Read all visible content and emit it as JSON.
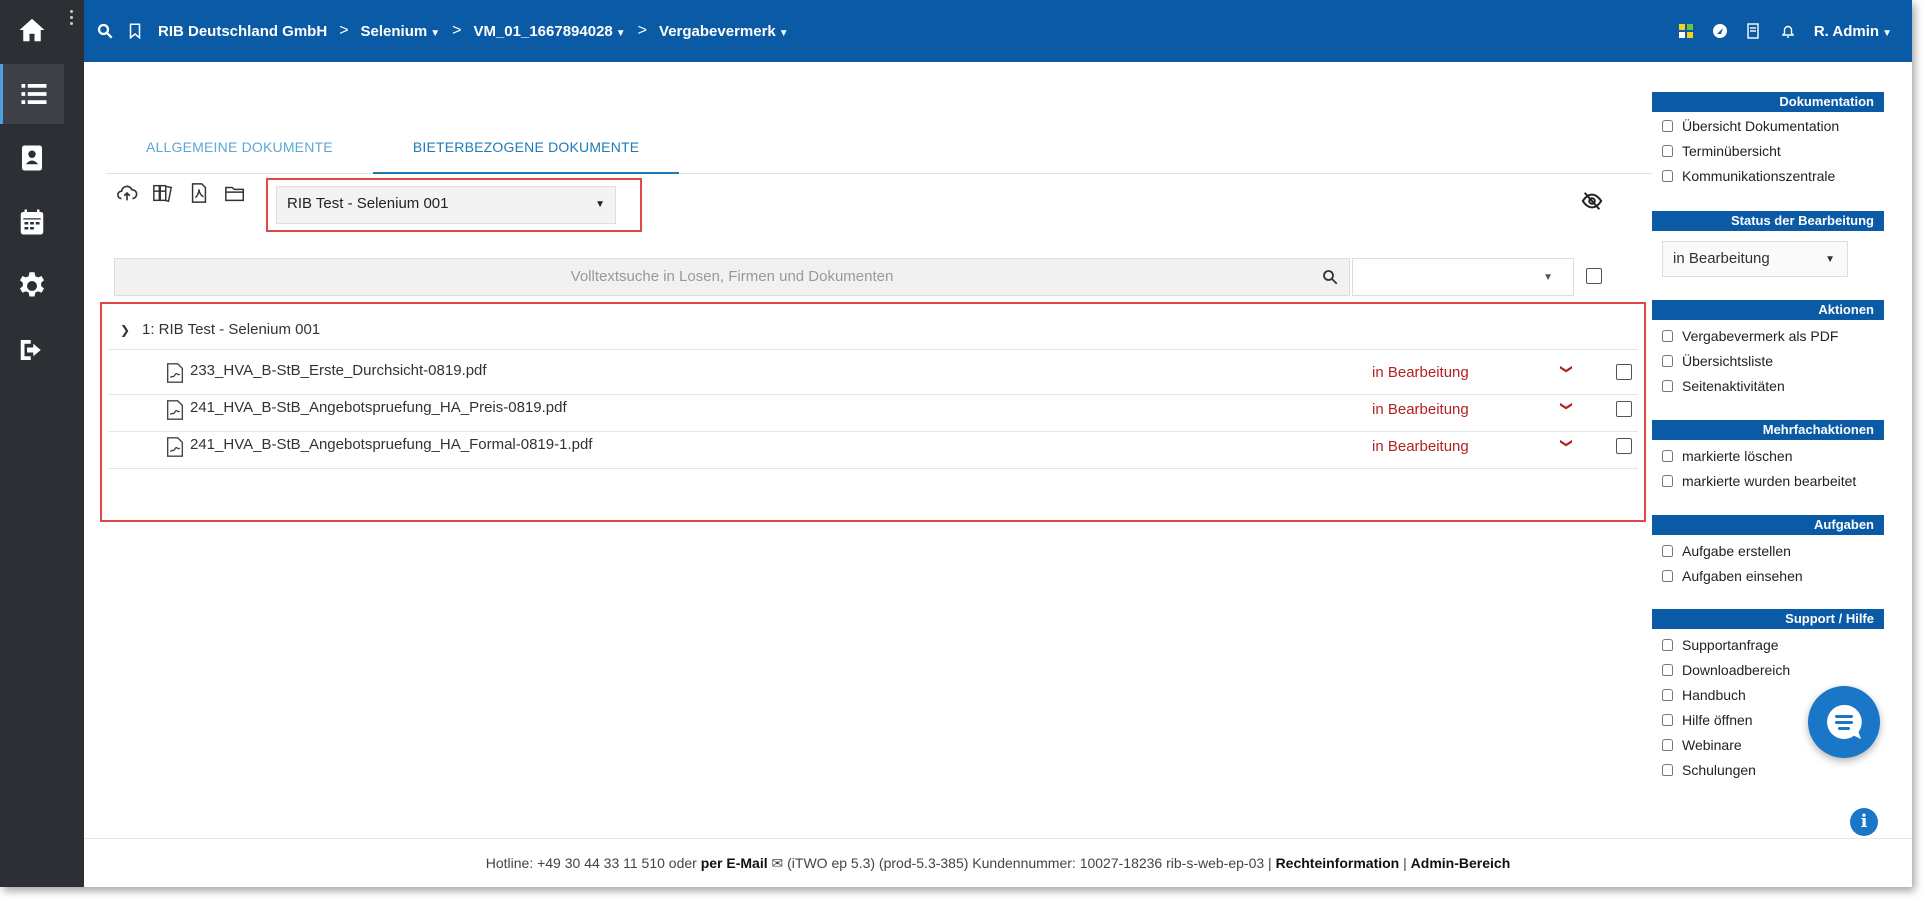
{
  "header": {
    "breadcrumb": [
      {
        "label": "RIB Deutschland GmbH",
        "dropdown": false
      },
      {
        "label": "Selenium",
        "dropdown": true
      },
      {
        "label": "VM_01_1667894028",
        "dropdown": true
      },
      {
        "label": "Vergabevermerk",
        "dropdown": true
      }
    ],
    "user": "R. Admin"
  },
  "tabs": [
    {
      "label": "ALLGEMEINE DOKUMENTE",
      "active": false
    },
    {
      "label": "BIETERBEZOGENE DOKUMENTE",
      "active": true
    }
  ],
  "bidder_select": {
    "value": "RIB Test - Selenium 001"
  },
  "search": {
    "placeholder": "Volltextsuche in Losen, Firmen und Dokumenten"
  },
  "group": {
    "label": "1: RIB Test - Selenium 001"
  },
  "documents": [
    {
      "name": "233_HVA_B-StB_Erste_Durchsicht-0819.pdf",
      "status": "in Bearbeitung"
    },
    {
      "name": "241_HVA_B-StB_Angebotspruefung_HA_Preis-0819.pdf",
      "status": "in Bearbeitung"
    },
    {
      "name": "241_HVA_B-StB_Angebotspruefung_HA_Formal-0819-1.pdf",
      "status": "in Bearbeitung"
    }
  ],
  "right_panel": {
    "dokumentation": {
      "title": "Dokumentation",
      "items": [
        "Übersicht Dokumentation",
        "Terminübersicht",
        "Kommunikationszentrale"
      ]
    },
    "status": {
      "title": "Status der Bearbeitung",
      "value": "in Bearbeitung"
    },
    "aktionen": {
      "title": "Aktionen",
      "items": [
        "Vergabevermerk als PDF",
        "Übersichtsliste",
        "Seitenaktivitäten"
      ]
    },
    "mehrfach": {
      "title": "Mehrfachaktionen",
      "items": [
        "markierte löschen",
        "markierte wurden bearbeitet"
      ]
    },
    "aufgaben": {
      "title": "Aufgaben",
      "items": [
        "Aufgabe erstellen",
        "Aufgaben einsehen"
      ]
    },
    "support": {
      "title": "Support / Hilfe",
      "items": [
        "Supportanfrage",
        "Downloadbereich",
        "Handbuch",
        "Hilfe öffnen",
        "Webinare",
        "Schulungen"
      ]
    }
  },
  "footer": {
    "hotline": "Hotline: +49 30 44 33 11 510 oder",
    "email": "per E-Mail",
    "version": "(iTWO ep 5.3) (prod-5.3-385)   Kundennummer: 10027-18236 rib-s-web-ep-03 |",
    "legal": "Rechteinformation",
    "sep": "|",
    "admin": "Admin-Bereich"
  },
  "colors": {
    "brand": "#0b5aa5",
    "sidebar": "#2c2f33",
    "status": "#b22222",
    "highlight": "#e04848",
    "tab_active": "#1f7ab8"
  }
}
